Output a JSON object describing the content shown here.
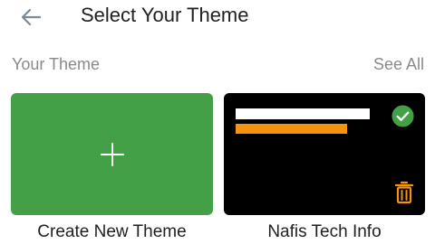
{
  "header": {
    "title": "Select Your Theme",
    "back_icon": "arrow-left-icon"
  },
  "section": {
    "label": "Your Theme",
    "see_all": "See All"
  },
  "tiles": [
    {
      "caption": "Create New Theme",
      "icon": "plus-icon",
      "color": "#43a047"
    },
    {
      "caption": "Nafis Tech Info",
      "selected": true,
      "background": "#000000",
      "accent": "#f5930e",
      "check_color": "#43a047",
      "icons": [
        "check-circle-icon",
        "trash-icon"
      ]
    }
  ]
}
